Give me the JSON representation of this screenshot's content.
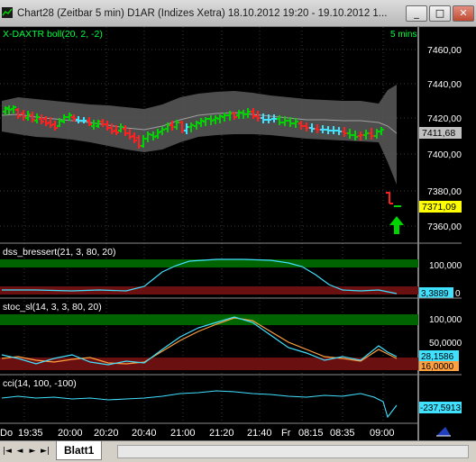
{
  "window": {
    "title": "Chart28 (Zeitbar 5 min)  D1AR (Indizes Xetra) 18.10.2012 19:20 - 19.10.2012 1...",
    "buttons": {
      "minimize": "_",
      "maximize": "□",
      "close": "✕"
    }
  },
  "main_panel": {
    "label": "X-DAXTR boll(20, 2, -2)",
    "interval": "5 mins",
    "price_ticks": [
      "7460,00",
      "7440,00",
      "7420,00",
      "7400,00",
      "7380,00",
      "7360,00"
    ],
    "last_price": "7411,68",
    "signal_price": "7371,09"
  },
  "dss_panel": {
    "label": "dss_bressert(21, 3, 80, 20)",
    "ticks": [
      "100,0000",
      "0"
    ],
    "value": "3,3889"
  },
  "stoc_panel": {
    "label": "stoc_sl(14, 3, 3, 80, 20)",
    "ticks": [
      "100,0000",
      "50,0000"
    ],
    "value_k": "28,1586",
    "value_d": "16,0000"
  },
  "cci_panel": {
    "label": "cci(14, 100, -100)",
    "value": "-237,5913"
  },
  "time_axis": {
    "labels": [
      "Do",
      "19:35",
      "20:00",
      "20:20",
      "20:40",
      "21:00",
      "21:20",
      "21:40",
      "Fr",
      "08:15",
      "08:35",
      "09:00"
    ]
  },
  "tabbar": {
    "tab_label": "Blatt1",
    "nav": [
      "|◄",
      "◄",
      "►",
      "►|"
    ]
  },
  "colors": {
    "up_bar": "#00d400",
    "down_bar": "#ff2020",
    "neutral_bar": "#40e0ff",
    "band": "#606060",
    "overbought_zone": "#006400",
    "oversold_zone": "#6a1010",
    "dss_line": "#40e0ff",
    "stoc_k": "#40e0ff",
    "stoc_d": "#ffa040",
    "cci_line": "#40e0ff",
    "last_price_bg": "#c0c0c0",
    "signal_price_bg": "#ffff00"
  },
  "icons": {
    "buy_arrow": "green-up-arrow-icon",
    "signal": "red-signal-icon",
    "app": "chart-app-icon",
    "chart_tool": "blue-triangle-icon"
  }
}
